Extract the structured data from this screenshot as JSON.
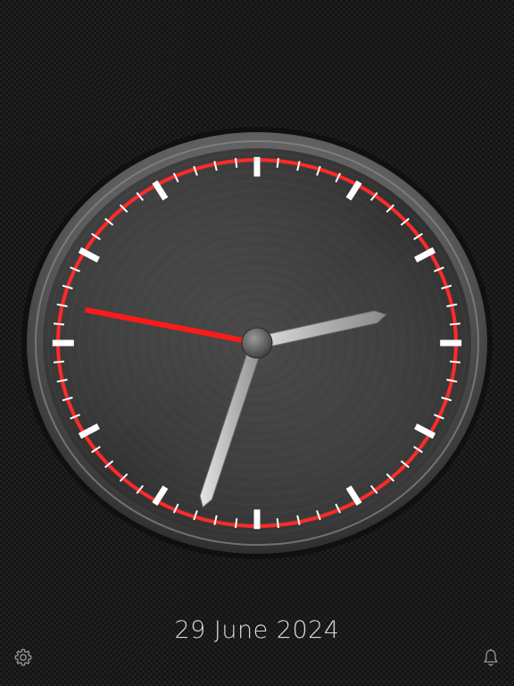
{
  "clock": {
    "time": {
      "hours": 2,
      "minutes": 32,
      "seconds": 47
    },
    "colors": {
      "second_hand": "#ff1a1a",
      "minute_track": "#ff2a2a",
      "tick_marks": "#ffffff",
      "hands": "#bdbdbd",
      "dial": "#3a3a3a",
      "bezel": "#6a6a6a"
    }
  },
  "date_label": "29 June 2024",
  "toolbar": {
    "settings_icon": "gear-icon",
    "alarm_icon": "bell-icon"
  }
}
